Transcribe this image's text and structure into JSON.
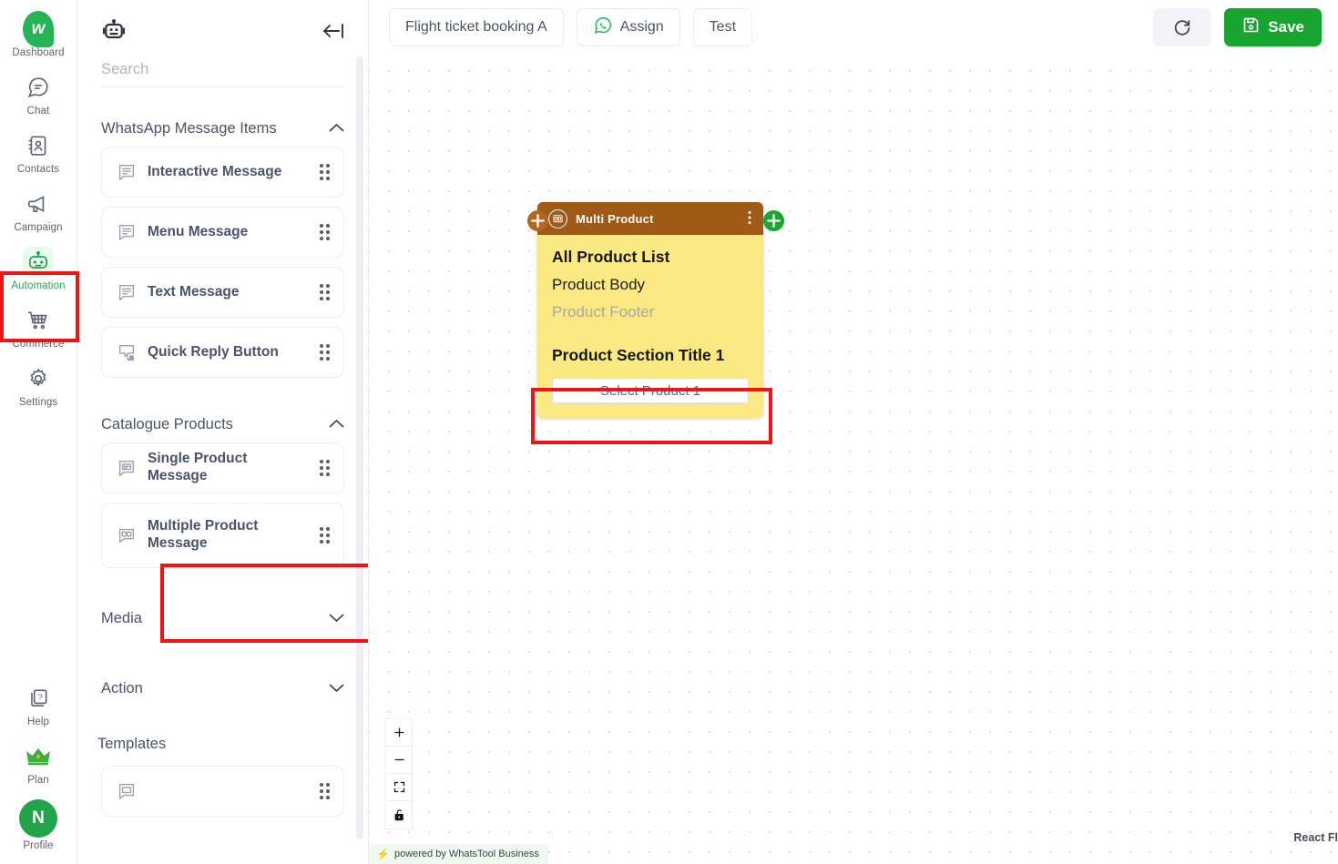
{
  "rail": {
    "items": [
      {
        "label": "Dashboard",
        "icon": "whatstool-logo-icon",
        "active": false
      },
      {
        "label": "Chat",
        "icon": "chat-bubble-icon",
        "active": false
      },
      {
        "label": "Contacts",
        "icon": "contacts-book-icon",
        "active": false
      },
      {
        "label": "Campaign",
        "icon": "megaphone-icon",
        "active": false
      },
      {
        "label": "Automation",
        "icon": "robot-icon",
        "active": true
      },
      {
        "label": "Commerce",
        "icon": "shopping-cart-icon",
        "active": false
      },
      {
        "label": "Settings",
        "icon": "gear-icon",
        "active": false
      }
    ],
    "bottom_items": [
      {
        "label": "Help",
        "icon": "help-question-icon"
      },
      {
        "label": "Plan",
        "icon": "crown-icon"
      },
      {
        "label": "Profile",
        "icon": "avatar-icon",
        "initial": "N"
      }
    ],
    "active_highlight_color": "#f01414"
  },
  "panel": {
    "header_icon": "robot-icon",
    "collapse_icon": "collapse-left-icon",
    "search": {
      "value": "",
      "placeholder": "Search"
    },
    "sections": [
      {
        "title": "WhatsApp Message Items",
        "expanded": true,
        "chevron": "chevron-up-icon",
        "items": [
          {
            "label": "Interactive Message",
            "icon": "message-lines-icon"
          },
          {
            "label": "Menu Message",
            "icon": "message-lines-icon"
          },
          {
            "label": "Text Message",
            "icon": "message-lines-icon"
          },
          {
            "label": "Quick Reply Button",
            "icon": "quick-reply-icon"
          }
        ]
      },
      {
        "title": "Catalogue Products",
        "expanded": true,
        "chevron": "chevron-up-icon",
        "items": [
          {
            "label": "Single Product Message",
            "icon": "single-product-icon"
          },
          {
            "label": "Multiple Product Message",
            "icon": "multi-product-icon",
            "highlighted": true
          }
        ]
      },
      {
        "title": "Media",
        "expanded": false,
        "chevron": "chevron-down-icon",
        "items": []
      },
      {
        "title": "Action",
        "expanded": false,
        "chevron": "chevron-down-icon",
        "items": []
      }
    ],
    "templates_title": "Templates"
  },
  "toolbar": {
    "flow_name": "Flight ticket booking A",
    "assign_label": "Assign",
    "assign_icon": "whatsapp-icon",
    "test_label": "Test",
    "refresh_icon": "refresh-icon",
    "save_label": "Save",
    "save_icon": "floppy-disk-icon",
    "save_color": "#16a52e"
  },
  "canvas": {
    "node": {
      "header_title": "Multi Product",
      "header_icon": "multi-product-icon",
      "header_color": "#a05a16",
      "body_color": "#fbea84",
      "kebab_icon": "kebab-menu-icon",
      "left_handle_icon": "plus-handle-icon",
      "left_handle_color": "#b5651d",
      "right_handle_icon": "plus-handle-icon",
      "right_handle_color": "#18a832",
      "product_list_title": "All Product List",
      "product_body": "Product Body",
      "product_footer": "Product Footer",
      "section_title": "Product Section Title 1",
      "select_product_label": "Select Product 1",
      "highlight_color": "#f01414"
    },
    "zoom_controls": [
      {
        "icon": "zoom-in-icon",
        "label": "+"
      },
      {
        "icon": "zoom-out-icon",
        "label": "–"
      },
      {
        "icon": "fit-view-icon",
        "label": ""
      },
      {
        "icon": "lock-icon",
        "label": ""
      }
    ],
    "watermark": "powered by WhatsTool Business",
    "attribution": "React Fl"
  }
}
